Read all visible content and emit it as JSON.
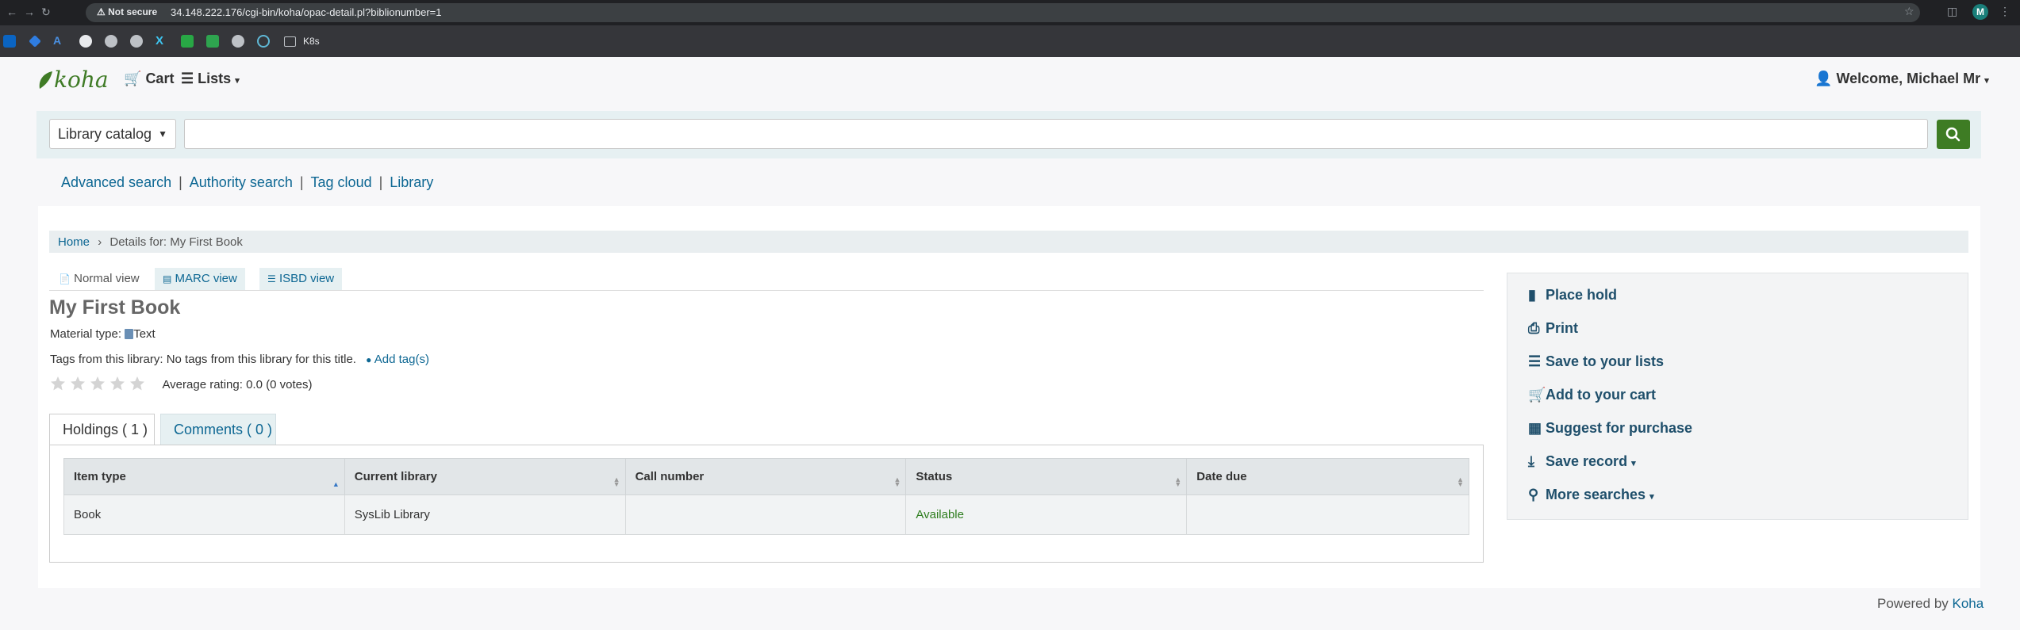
{
  "browser": {
    "security_label": "Not secure",
    "url": "34.148.222.176/cgi-bin/koha/opac-detail.pl?biblionumber=1",
    "bookmark_folder": "K8s",
    "profile_initial": "M"
  },
  "header": {
    "logo_text": "koha",
    "cart_label": "Cart",
    "lists_label": "Lists",
    "welcome_label": "Welcome, Michael Mr"
  },
  "search": {
    "scope_selected": "Library catalog",
    "query_value": "",
    "submit_icon": "search-icon"
  },
  "more_searches": {
    "items": [
      "Advanced search",
      "Authority search",
      "Tag cloud",
      "Library"
    ]
  },
  "breadcrumb": {
    "home": "Home",
    "current": "Details for: My First Book"
  },
  "view_tabs": [
    "Normal view",
    "MARC view",
    "ISBD view"
  ],
  "record": {
    "title": "My First Book",
    "material_type_label": "Material type:",
    "material_type_value": "Text",
    "tags_label": "Tags from this library:",
    "tags_value": "No tags from this library for this title.",
    "add_tags_label": "Add tag(s)",
    "rating_text": "Average rating: 0.0 (0 votes)",
    "rating_value": 0,
    "rating_max": 5
  },
  "holdings_tabs": [
    "Holdings ( 1 )",
    "Comments ( 0 )"
  ],
  "holdings": {
    "columns": [
      "Item type",
      "Current library",
      "Call number",
      "Status",
      "Date due"
    ],
    "rows": [
      [
        "Book",
        "SysLib Library",
        "",
        "Available",
        ""
      ]
    ]
  },
  "actions": [
    "Place hold",
    "Print",
    "Save to your lists",
    "Add to your cart",
    "Suggest for purchase",
    "Save record",
    "More searches"
  ],
  "footer": {
    "powered_prefix": "Powered by",
    "powered_link": "Koha"
  },
  "colors": {
    "brand_green": "#3e7c24",
    "link_blue": "#0d6793",
    "available_green": "#2e7d1e"
  }
}
